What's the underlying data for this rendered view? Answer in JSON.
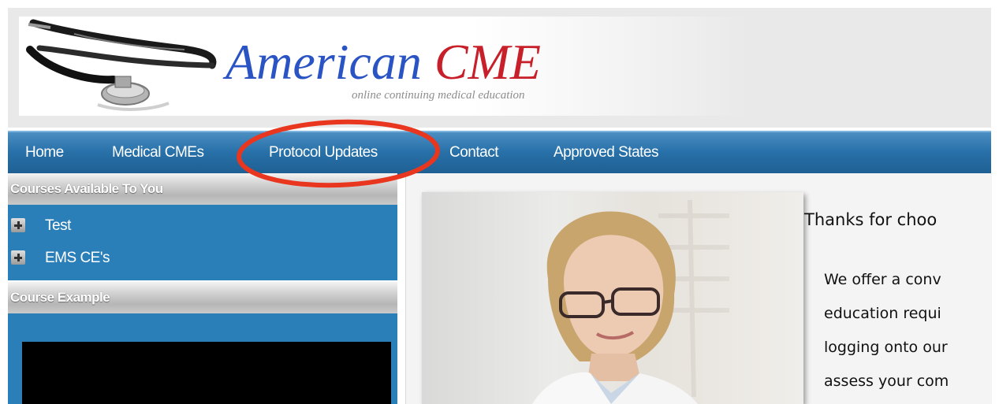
{
  "header": {
    "logo_word1": "American",
    "logo_word2": "CME",
    "tagline": "online continuing medical education"
  },
  "nav": {
    "items": [
      {
        "label": "Home"
      },
      {
        "label": "Medical CMEs"
      },
      {
        "label": "Protocol Updates"
      },
      {
        "label": "Contact"
      },
      {
        "label": "Approved States"
      }
    ],
    "highlighted_item": "Protocol Updates",
    "highlight_color": "#e8361f"
  },
  "sidebar": {
    "courses_title": "Courses Available To You",
    "courses": [
      {
        "label": "Test"
      },
      {
        "label": "EMS CE's"
      }
    ],
    "example_title": "Course Example"
  },
  "main": {
    "heading": "Thanks for choo",
    "lines": [
      "We offer a conv",
      "education requi",
      "logging onto our",
      "assess your com"
    ]
  },
  "colors": {
    "nav_blue": "#2871a9",
    "logo_blue": "#2a53c4",
    "logo_red": "#c8202a",
    "panel_blue": "#2b7fb8"
  }
}
